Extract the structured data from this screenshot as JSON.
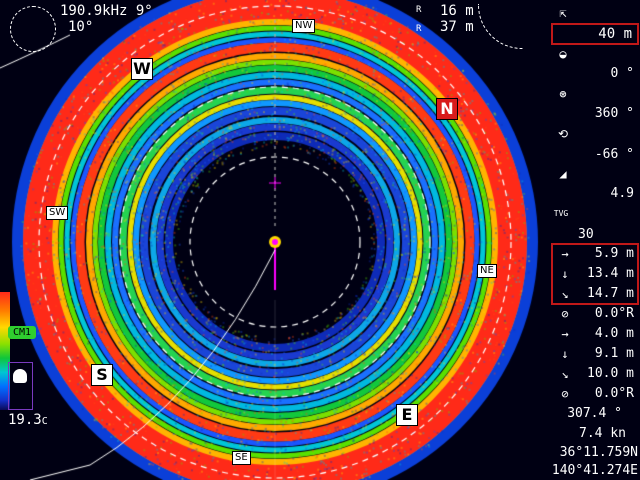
{
  "header": {
    "frequency_tilt": "190.9kHz 9°",
    "gain_line": "10°",
    "range_top": "16 m",
    "range_bottom": "37 m",
    "range_icon_top": "R",
    "range_icon_bottom": "R"
  },
  "compass": {
    "labels": {
      "nw": "NW",
      "n": "N",
      "w": "W",
      "sw": "SW",
      "ne": "NE",
      "s": "S",
      "e": "E",
      "se": "SE"
    }
  },
  "right_panel": {
    "range_value": "40 m",
    "tilt_value": "0 °",
    "sector_value": "360 °",
    "gain_value": "-66 °",
    "tx_value": "4.9",
    "tvg_label": "TVG",
    "tvg_value": "30",
    "marker_distances": [
      {
        "icon": "arrow-right-icon",
        "value": "5.9 m"
      },
      {
        "icon": "arrow-down-icon",
        "value": "13.4 m"
      },
      {
        "icon": "arrow-diag-icon",
        "value": "14.7 m"
      }
    ],
    "cursor_bearing_1": "0.0°R",
    "cursor_list": [
      {
        "icon": "arrow-right-icon",
        "value": "4.0 m"
      },
      {
        "icon": "arrow-down-icon",
        "value": "9.1 m"
      },
      {
        "icon": "arrow-diag-icon",
        "value": "10.0 m"
      }
    ],
    "cursor_bearing_2": "0.0°R",
    "heading": "307.4 °",
    "speed": "7.4 kn",
    "latitude": "36°11.759N",
    "longitude": "140°41.274E"
  },
  "left_panel": {
    "cm_badge": "CM1",
    "water_temp": "19.3",
    "temp_unit": "C"
  },
  "colors": {
    "accent_red": "#c01818",
    "north_label": "#d81b1b",
    "heading_line": "#ff00ff",
    "background": "#000013"
  }
}
